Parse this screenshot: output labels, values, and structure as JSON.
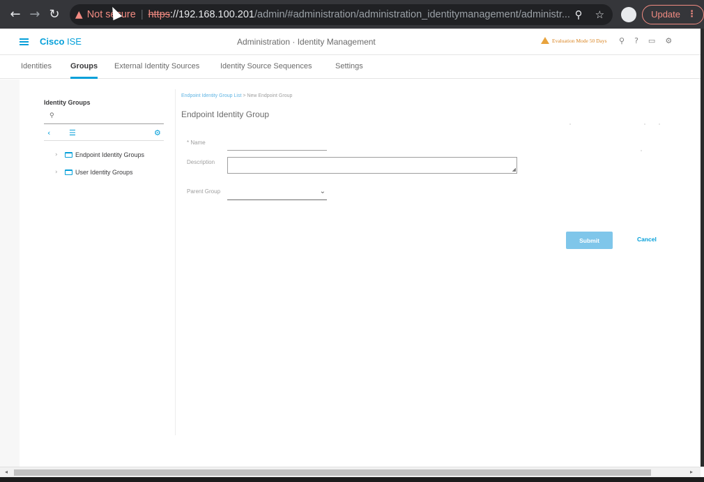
{
  "browser": {
    "security_label": "Not secure",
    "url_scheme": "https",
    "url_host": "://192.168.100.201",
    "url_path": "/admin/#administration/administration_identitymanagement/administr...",
    "update_label": "Update"
  },
  "header": {
    "brand_bold": "Cisco",
    "brand_light": " ISE",
    "title": "Administration · Identity Management",
    "eval_badge": "Evaluation Mode 50 Days"
  },
  "tabs": [
    {
      "label": "Identities"
    },
    {
      "label": "Groups"
    },
    {
      "label": "External Identity Sources"
    },
    {
      "label": "Identity Source Sequences"
    },
    {
      "label": "Settings"
    }
  ],
  "left_panel": {
    "title": "Identity Groups",
    "search_placeholder": "",
    "tree": [
      {
        "label": "Endpoint Identity Groups"
      },
      {
        "label": "User Identity Groups"
      }
    ]
  },
  "form": {
    "breadcrumb_link": "Endpoint Identity Group List",
    "breadcrumb_sep": ">",
    "breadcrumb_current": "New Endpoint Group",
    "title": "Endpoint Identity Group",
    "name_label": "* Name",
    "description_label": "Description",
    "parent_label": "Parent Group",
    "submit_label": "Submit",
    "cancel_label": "Cancel"
  },
  "colors": {
    "accent": "#049fd9",
    "warning": "#e8a33d",
    "submit_disabled": "#7fc6ea"
  }
}
